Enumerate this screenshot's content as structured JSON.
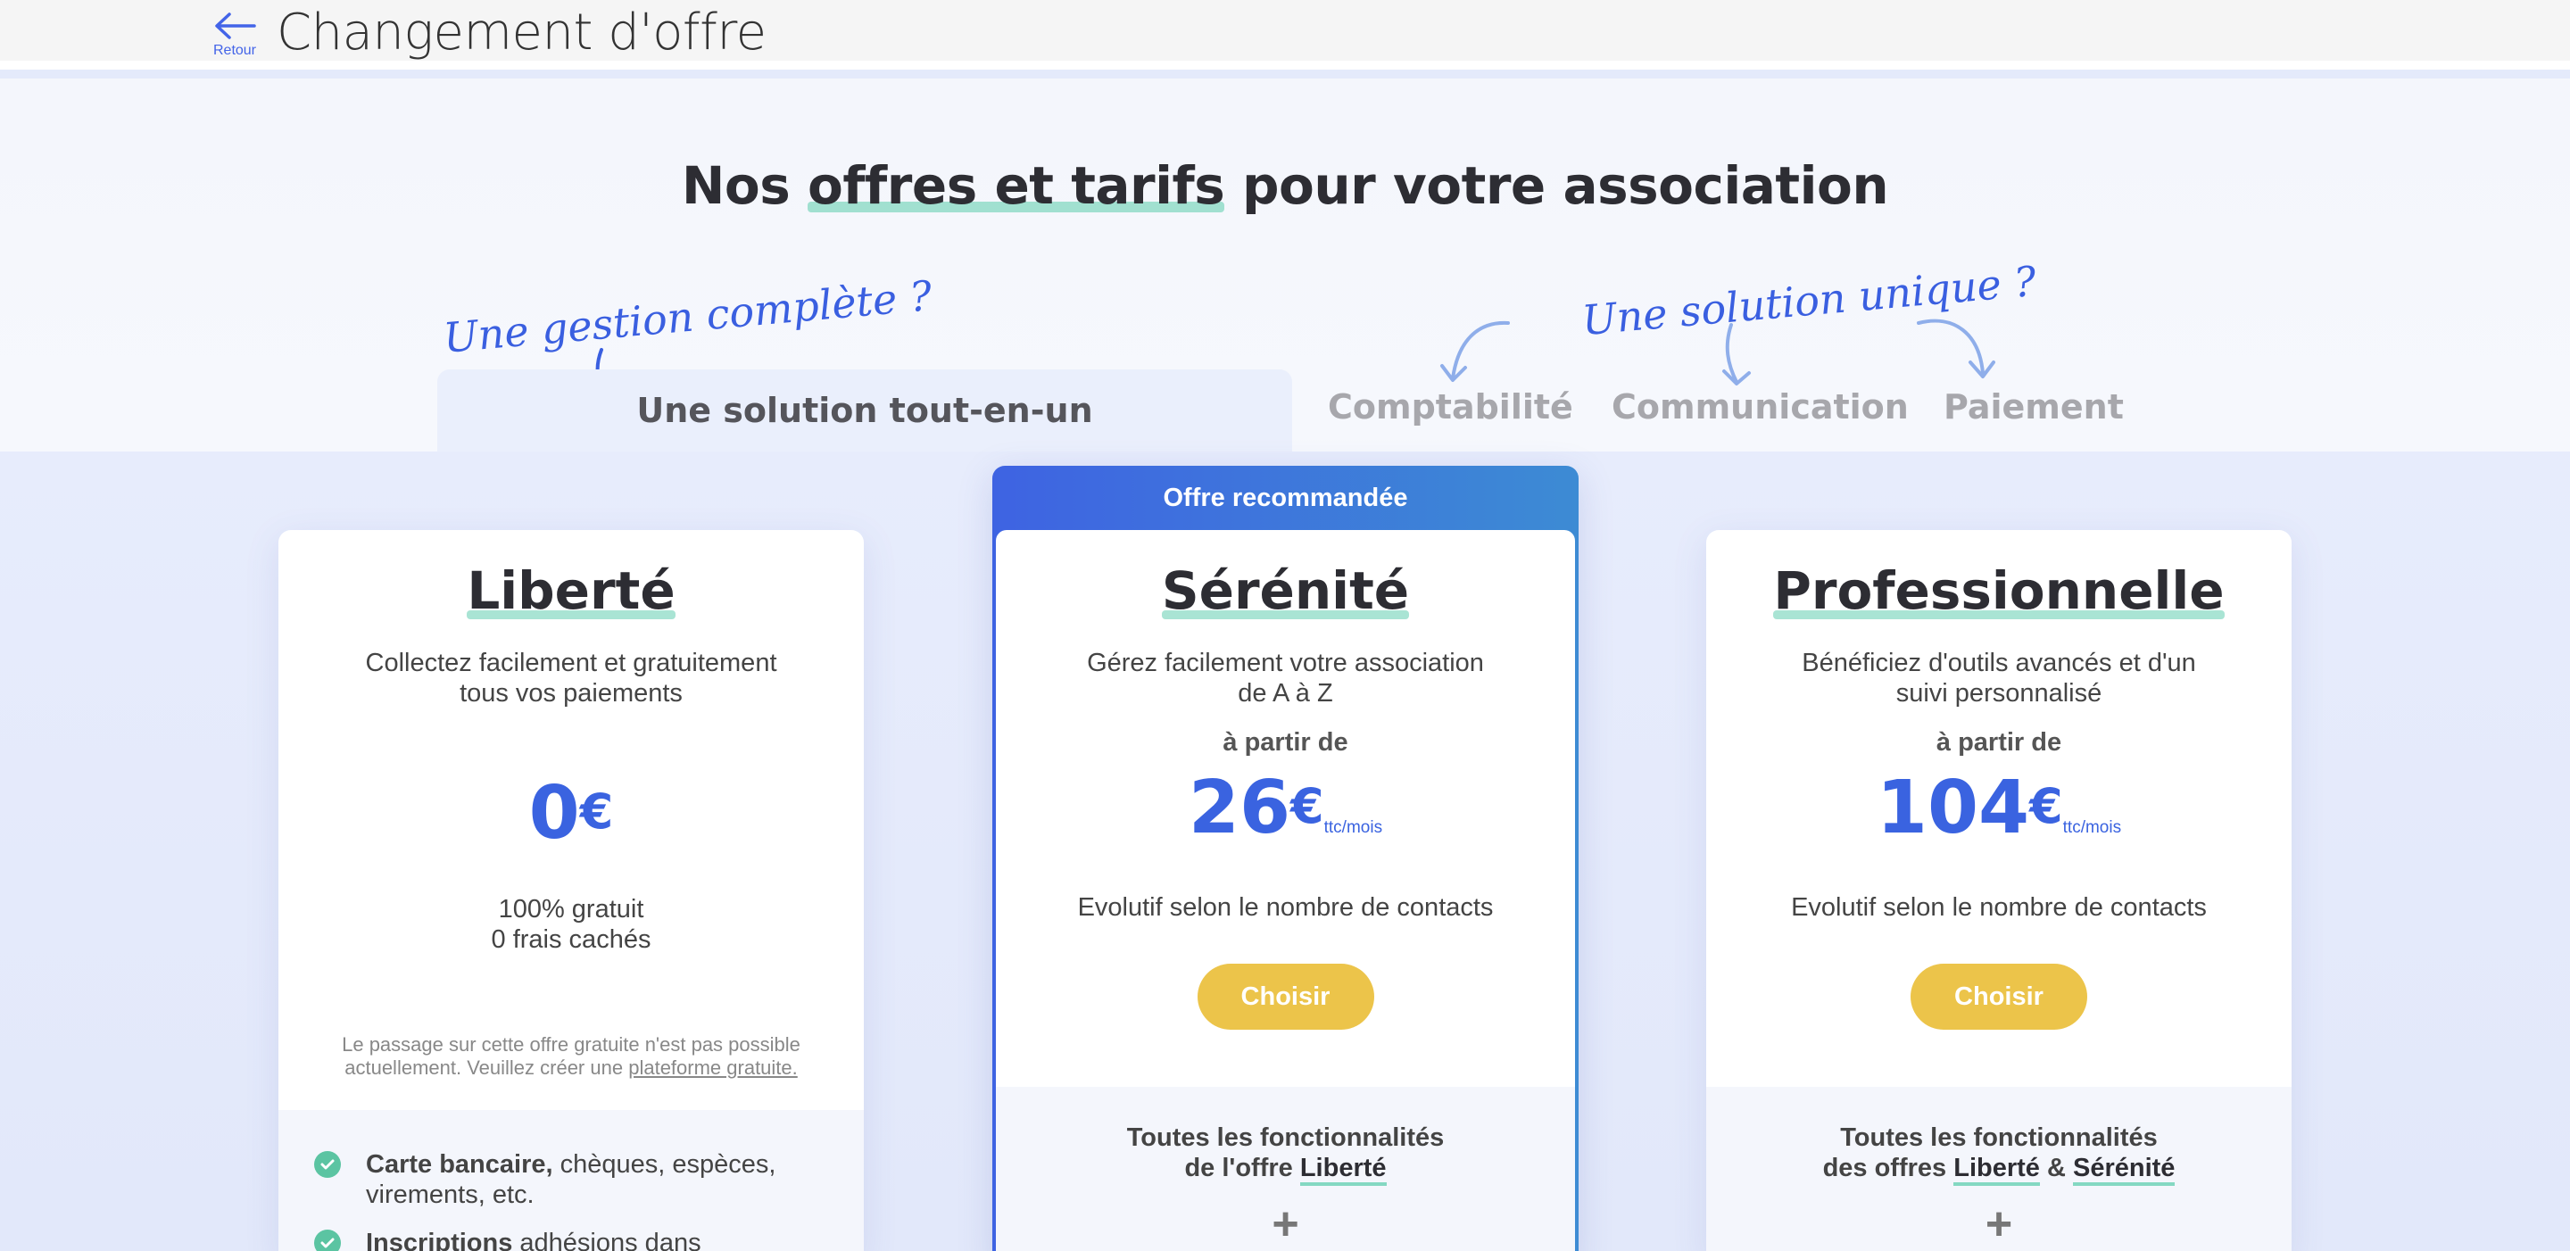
{
  "topbar": {
    "back_label": "Retour",
    "title": "Changement d'offre"
  },
  "hero": {
    "title_before": "Nos",
    "title_highlight": "offres et tarifs",
    "title_after": "pour votre association",
    "script_left": "Une gestion complète ?",
    "script_right": "Une solution unique ?"
  },
  "tabs": {
    "active": "Une solution tout-en-un",
    "items": [
      "Comptabilité",
      "Communication",
      "Paiement"
    ]
  },
  "plans": [
    {
      "name": "Liberté",
      "desc_line1": "Collectez facilement et gratuitement",
      "desc_line2": "tous vos paiements",
      "price": "0",
      "currency": "€",
      "note_line1": "100% gratuit",
      "note_line2": "0 frais cachés",
      "disclaimer_line1": "Le passage sur cette offre gratuite n'est pas possible",
      "disclaimer_line2": "actuellement. Veuillez créer une",
      "disclaimer_link": "plateforme gratuite.",
      "features": [
        {
          "bold": "Carte bancaire,",
          "rest": " chèques, espèces,",
          "line2": "virements, etc."
        },
        {
          "bold": "Inscriptions",
          "rest": " adhésions dans",
          "line2": ""
        }
      ]
    },
    {
      "badge": "Offre recommandée",
      "name": "Sérénité",
      "desc_line1": "Gérez facilement votre association",
      "desc_line2": "de A à Z",
      "from": "à partir de",
      "price": "26",
      "currency": "€",
      "unit": "ttc/mois",
      "note": "Evolutif selon le nombre de contacts",
      "button": "Choisir",
      "feat_line1": "Toutes les fonctionnalités",
      "feat_line2_prefix": "de l'offre ",
      "feat_line2_u1": "Liberté",
      "plus": "+"
    },
    {
      "name": "Professionnelle",
      "desc_line1": "Bénéficiez d'outils avancés et d'un",
      "desc_line2": "suivi personnalisé",
      "from": "à partir de",
      "price": "104",
      "currency": "€",
      "unit": "ttc/mois",
      "note": "Evolutif selon le nombre de contacts",
      "button": "Choisir",
      "feat_line1": "Toutes les fonctionnalités",
      "feat_line2_prefix": "des offres ",
      "feat_line2_u1": "Liberté",
      "feat_line2_mid": " & ",
      "feat_line2_u2": "Sérénité",
      "plus": "+"
    }
  ],
  "colors": {
    "accent": "#3a63e0",
    "highlight": "#84d8c2",
    "button": "#ecc44a",
    "check": "#5bc4a2"
  }
}
